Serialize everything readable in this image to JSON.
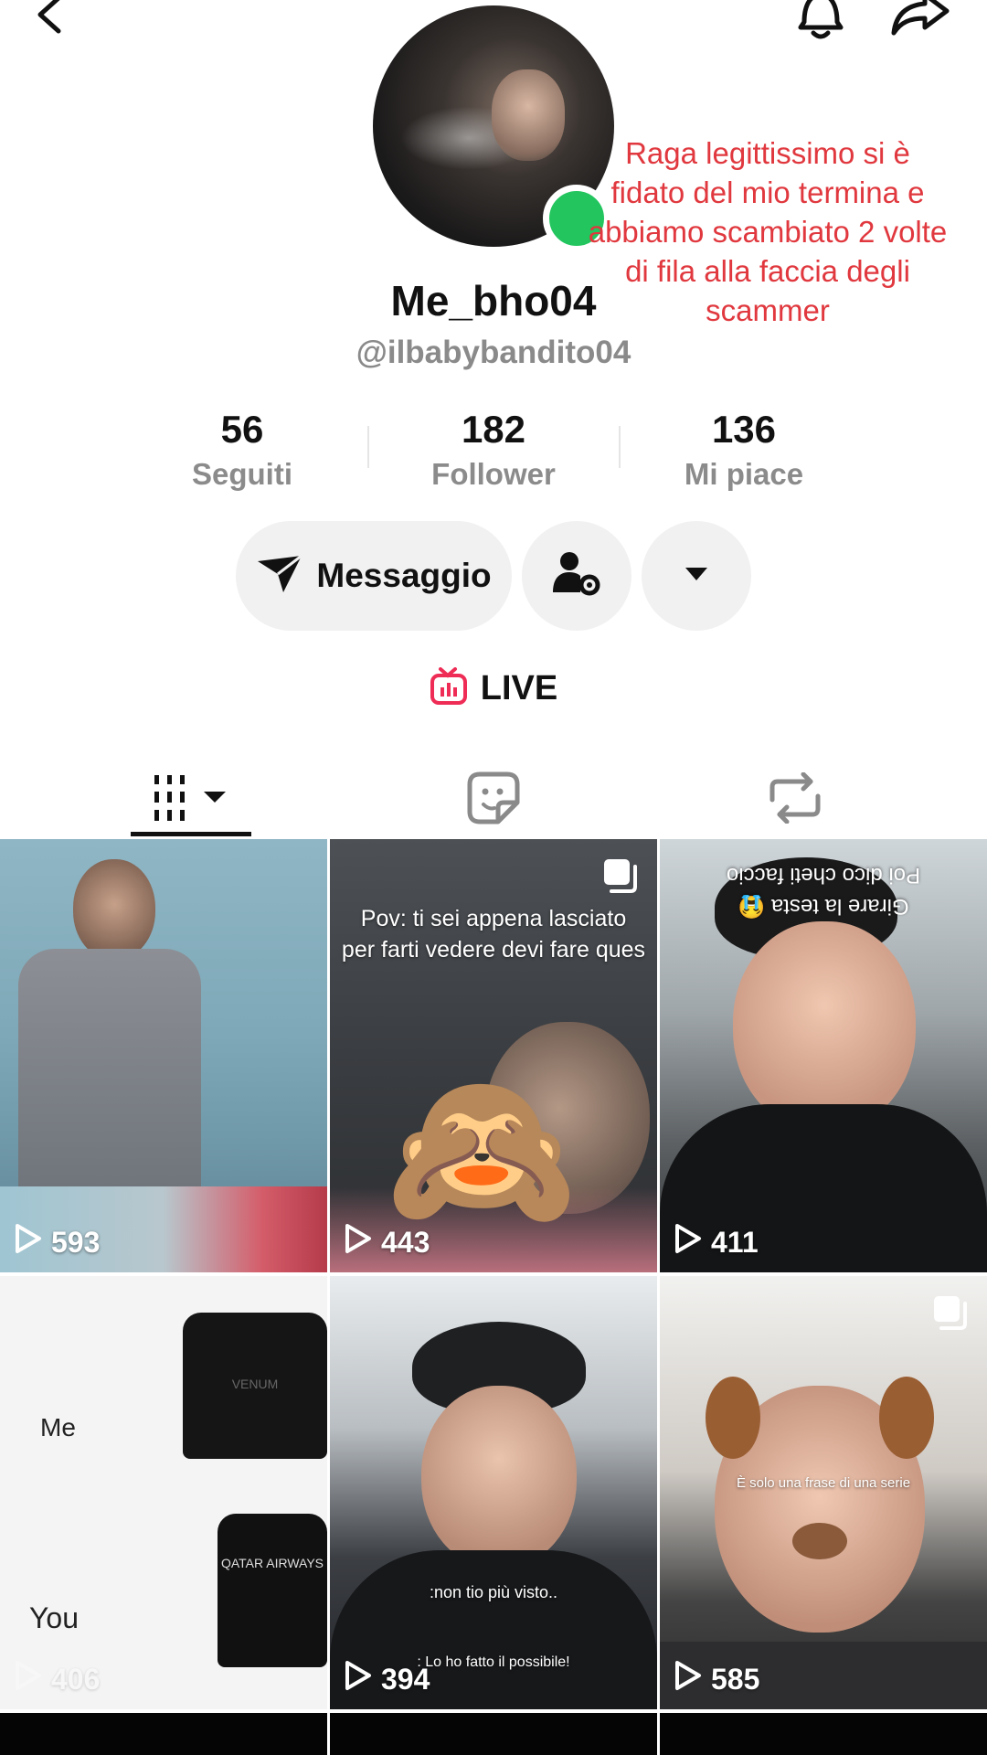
{
  "profile": {
    "display_name": "Me_bho04",
    "handle": "@ilbabybandito04",
    "online": true,
    "overlay_caption": "Raga legittissimo si è fidato del mio termina e abbiamo scambiato 2 volte di fila alla faccia degli scammer"
  },
  "stats": [
    {
      "value": "56",
      "label": "Seguiti"
    },
    {
      "value": "182",
      "label": "Follower"
    },
    {
      "value": "136",
      "label": "Mi piace"
    }
  ],
  "actions": {
    "message_label": "Messaggio",
    "follow_settings_icon": "user-gear-icon",
    "more_icon": "caret-down-icon"
  },
  "live": {
    "label": "LIVE"
  },
  "tabs": [
    {
      "icon": "grid-bars-icon",
      "active": true
    },
    {
      "icon": "sticker-icon",
      "active": false
    },
    {
      "icon": "repost-icon",
      "active": false
    }
  ],
  "videos": [
    {
      "views": "593",
      "multi": false,
      "text": ""
    },
    {
      "views": "443",
      "multi": true,
      "text": "Pov: ti sei appena lasciato\nper farti vedere devi fare ques"
    },
    {
      "views": "411",
      "multi": false,
      "text": "Girare la testa 😭\nPoi dico cheti faccio"
    },
    {
      "views": "406",
      "multi": true,
      "text_me": "Me",
      "text_you": "You",
      "shirt_top": "VENUM",
      "shirt_bottom": "QATAR AIRWAYS"
    },
    {
      "views": "394",
      "multi": false,
      "text": ":non tio più visto..",
      "text2": ": Lo ho fatto il possibile!"
    },
    {
      "views": "585",
      "multi": true,
      "text": "È solo una frase di una  serie"
    }
  ],
  "colors": {
    "online": "#22c55e",
    "caption": "#e0383e",
    "live_icon": "#ee2c55",
    "pill_bg": "#f1f1f2"
  }
}
